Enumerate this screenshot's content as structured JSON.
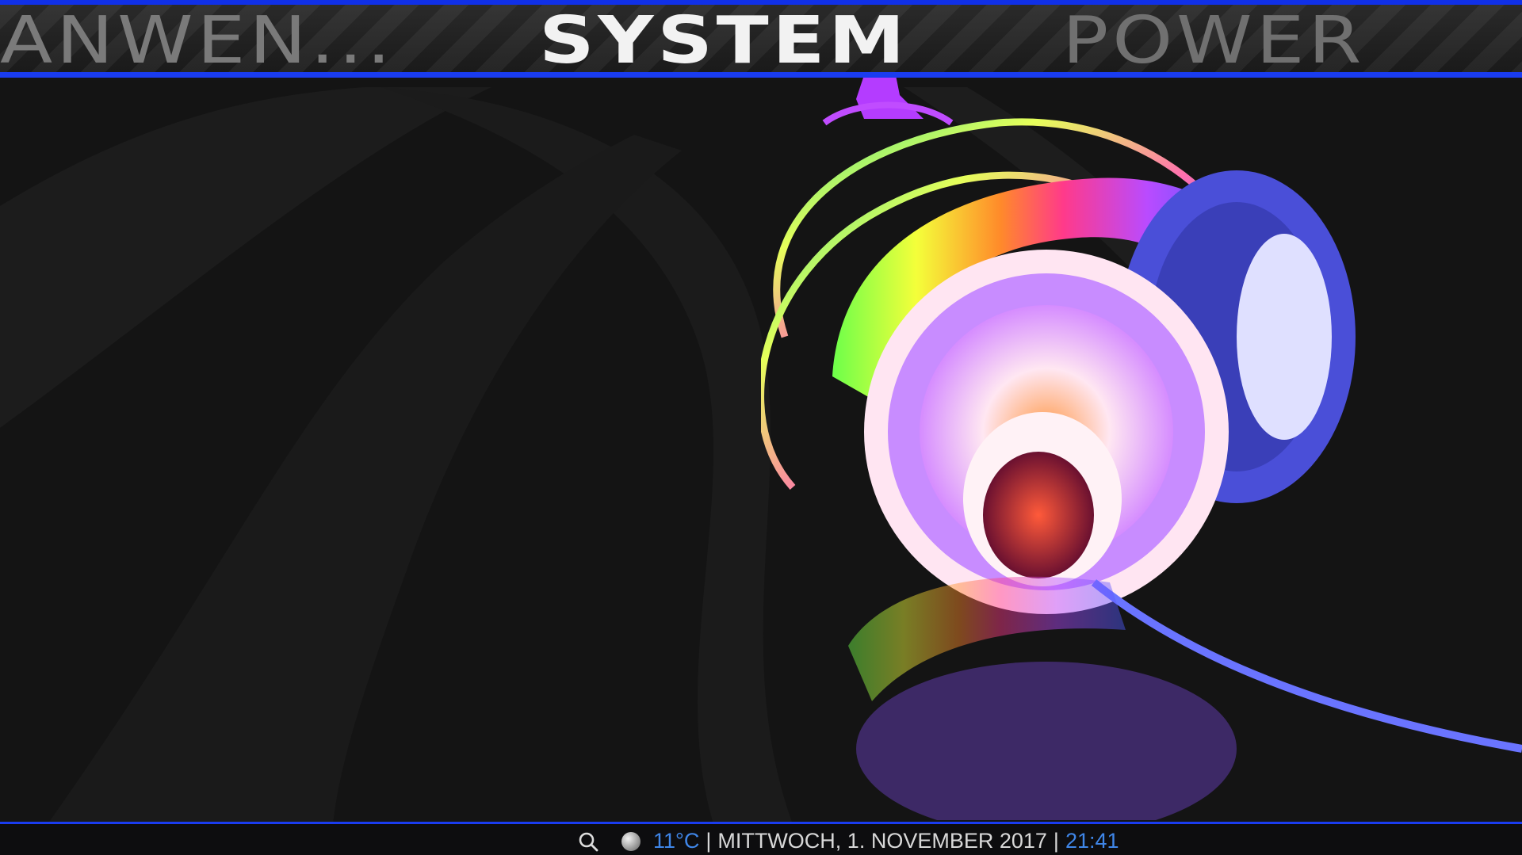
{
  "menu": {
    "items": [
      {
        "label": "ANWEN..."
      },
      {
        "label": "SYSTEM"
      },
      {
        "label": "POWER"
      }
    ],
    "accent_color": "#1a3cf0"
  },
  "background": {
    "subject": "headphones-artwork"
  },
  "status_bar": {
    "icons": [
      "search-icon",
      "weather-icon"
    ],
    "temperature": "11°C",
    "date": "MITTWOCH, 1. NOVEMBER 2017",
    "time": "21:41",
    "separator": "|",
    "highlight_color": "#3f86e8"
  }
}
